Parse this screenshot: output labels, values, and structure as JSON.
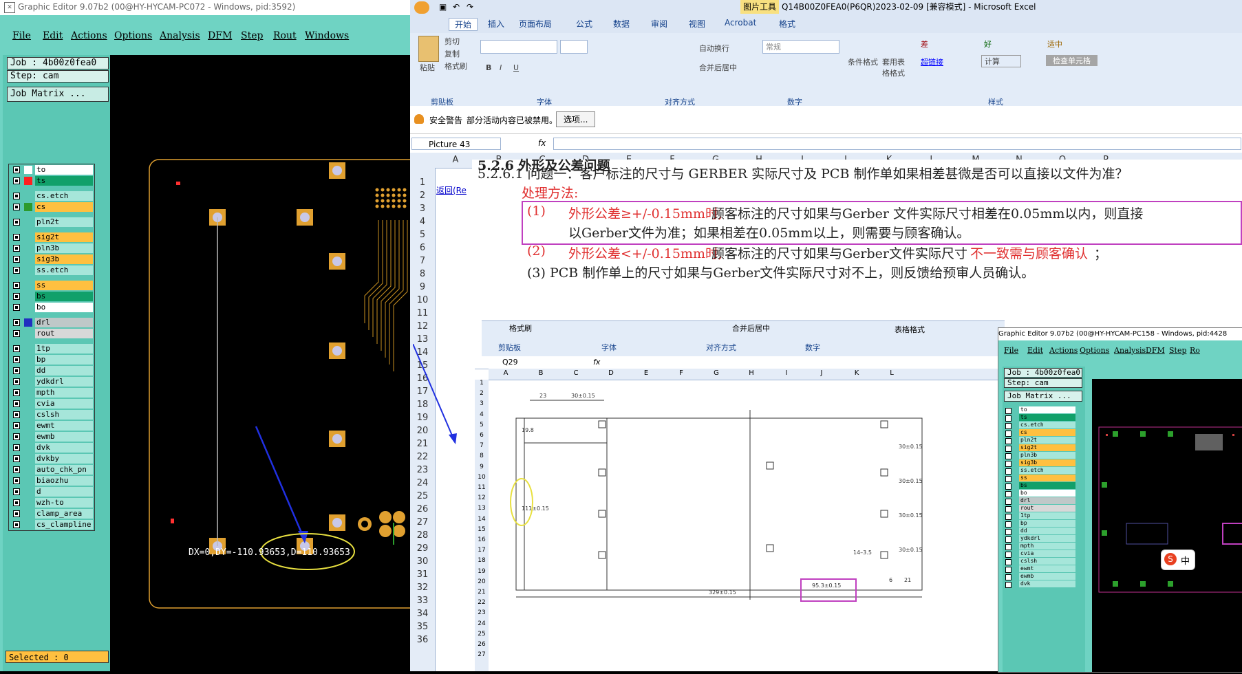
{
  "left_editor": {
    "title": "Graphic Editor 9.07b2 (00@HY-HYCAM-PC072 - Windows, pid:3592)",
    "menu": [
      "File",
      "Edit",
      "Actions",
      "Options",
      "Analysis",
      "DFM",
      "Step",
      "Rout",
      "Windows"
    ],
    "job": "Job : 4b00z0fea0",
    "step": "Step: cam",
    "job_matrix": "Job Matrix ...",
    "layers": [
      {
        "name": "to",
        "color": "#ffffff",
        "sw": "#ffffff"
      },
      {
        "name": "ts",
        "color": "#11a06a",
        "sw": "#ff2020"
      },
      {
        "name": "cs.etch",
        "color": "#a6e6da",
        "sw": "#5bc7b4"
      },
      {
        "name": "cs",
        "color": "#ffc040",
        "sw": "#2c9a2c"
      },
      {
        "name": "pln2t",
        "color": "#a6e6da",
        "sw": "#5bc7b4"
      },
      {
        "name": "sig2t",
        "color": "#ffc040",
        "sw": "#5bc7b4"
      },
      {
        "name": "pln3b",
        "color": "#a6e6da",
        "sw": "#5bc7b4"
      },
      {
        "name": "sig3b",
        "color": "#ffc040",
        "sw": "#5bc7b4"
      },
      {
        "name": "ss.etch",
        "color": "#a6e6da",
        "sw": "#5bc7b4"
      },
      {
        "name": "ss",
        "color": "#ffc040",
        "sw": "#5bc7b4"
      },
      {
        "name": "bs",
        "color": "#11a06a",
        "sw": "#5bc7b4"
      },
      {
        "name": "bo",
        "color": "#ffffff",
        "sw": "#5bc7b4"
      },
      {
        "name": "drl",
        "color": "#bfc8c8",
        "sw": "#2030c0"
      },
      {
        "name": "rout",
        "color": "#d8d8d8",
        "sw": "#5bc7b4"
      },
      {
        "name": "1tp",
        "color": "#a6e6da",
        "sw": "#5bc7b4"
      },
      {
        "name": "bp",
        "color": "#a6e6da",
        "sw": "#5bc7b4"
      },
      {
        "name": "dd",
        "color": "#a6e6da",
        "sw": "#5bc7b4"
      },
      {
        "name": "ydkdrl",
        "color": "#a6e6da",
        "sw": "#5bc7b4"
      },
      {
        "name": "mpth",
        "color": "#a6e6da",
        "sw": "#5bc7b4"
      },
      {
        "name": "cvia",
        "color": "#a6e6da",
        "sw": "#5bc7b4"
      },
      {
        "name": "cslsh",
        "color": "#a6e6da",
        "sw": "#5bc7b4"
      },
      {
        "name": "ewmt",
        "color": "#a6e6da",
        "sw": "#5bc7b4"
      },
      {
        "name": "ewmb",
        "color": "#a6e6da",
        "sw": "#5bc7b4"
      },
      {
        "name": "dvk",
        "color": "#a6e6da",
        "sw": "#5bc7b4"
      },
      {
        "name": "dvkby",
        "color": "#a6e6da",
        "sw": "#5bc7b4"
      },
      {
        "name": "auto_chk_pn",
        "color": "#a6e6da",
        "sw": "#5bc7b4"
      },
      {
        "name": "biaozhu",
        "color": "#a6e6da",
        "sw": "#5bc7b4"
      },
      {
        "name": "d",
        "color": "#a6e6da",
        "sw": "#5bc7b4"
      },
      {
        "name": "wzh-to",
        "color": "#a6e6da",
        "sw": "#5bc7b4"
      },
      {
        "name": "clamp_area",
        "color": "#a6e6da",
        "sw": "#5bc7b4"
      },
      {
        "name": "cs_clampline",
        "color": "#a6e6da",
        "sw": "#5bc7b4"
      }
    ],
    "measure": "DX=0,DY=-110.93653,D=110.93653",
    "selected": "Selected : 0"
  },
  "excel": {
    "ribbon_tool_label": "图片工具",
    "title": "Q14B00Z0FEA0(P6QR)2023-02-09 [兼容模式] - Microsoft Excel",
    "tabs": [
      "开始",
      "插入",
      "页面布局",
      "公式",
      "数据",
      "审阅",
      "视图",
      "Acrobat",
      "格式"
    ],
    "clipboard": {
      "paste": "粘贴",
      "cut": "剪切",
      "copy": "复制",
      "format_painter": "格式刷",
      "group": "剪贴板"
    },
    "font_group": "字体",
    "align": {
      "wrap": "自动换行",
      "merge": "合并后居中",
      "group": "对齐方式"
    },
    "number": {
      "format": "常规",
      "group": "数字"
    },
    "styles": {
      "cond": "条件格式",
      "table": "套用表格格式",
      "bad": "差",
      "good": "好",
      "neutral": "适中",
      "link": "超链接",
      "calc": "计算",
      "check": "检查单元格",
      "group": "样式"
    },
    "security": {
      "label": "安全警告",
      "msg": "部分活动内容已被禁用。",
      "btn": "选项..."
    },
    "name_box": "Picture 43",
    "fx": "fx",
    "columns": [
      "A",
      "B",
      "C",
      "D",
      "E",
      "F",
      "G",
      "H",
      "I",
      "J",
      "K",
      "L",
      "M",
      "N",
      "O",
      "P"
    ],
    "rows": [
      "1",
      "2",
      "3",
      "4",
      "5",
      "6",
      "7",
      "8",
      "9",
      "10",
      "11",
      "12",
      "13",
      "14",
      "15",
      "16",
      "17",
      "18",
      "19",
      "20",
      "21",
      "22",
      "23",
      "24",
      "25",
      "26",
      "27",
      "28",
      "29",
      "30",
      "31",
      "32",
      "33",
      "34",
      "35",
      "36"
    ],
    "back_link": "返回(Re",
    "doc": {
      "h1": "5.2.6 外形及公差问题",
      "q1": "5.2.6.1 问题一：客户标注的尺寸与 GERBER 实际尺寸及 PCB 制作单如果相差甚微是否可以直接以文件为准？",
      "method": "处理方法:",
      "p1_num": "(1)",
      "p1_red": "外形公差≥+/-0.15mm时,",
      "p1_rest": "顾客标注的尺寸如果与Gerber 文件实际尺寸相差在0.05mm以内，则直接",
      "p1_line2": "以Gerber文件为准；如果相差在0.05mm以上，则需要与顾客确认。",
      "p2_num": "(2)",
      "p2_red": "外形公差<+/-0.15mm时,",
      "p2_mid": "顾客标注的尺寸如果与Gerber文件实际尺寸",
      "p2_red2": "不一致需与顾客确认",
      "p2_end": "；",
      "p3": "(3) PCB 制作单上的尺寸如果与Gerber文件实际尺寸对不上，则反馈给预审人员确认。"
    },
    "inner": {
      "name_box": "Q29",
      "fx": "fx",
      "ribbon_items": [
        "格式刷",
        "剪贴板",
        "字体",
        "对齐方式",
        "合并后居中",
        "数字",
        "表格格式"
      ],
      "cols": [
        "A",
        "B",
        "C",
        "D",
        "E",
        "F",
        "G",
        "H",
        "I",
        "J",
        "K",
        "L"
      ],
      "rows": [
        "1",
        "2",
        "3",
        "4",
        "5",
        "6",
        "7",
        "8",
        "9",
        "10",
        "11",
        "12",
        "13",
        "14",
        "15",
        "16",
        "17",
        "18",
        "19",
        "20",
        "21",
        "22",
        "23",
        "24",
        "25",
        "26",
        "27"
      ],
      "dims": [
        "23",
        "30±0.15",
        "19.8",
        "111±0.15",
        "30±0.15",
        "30±0.15",
        "30±0.15",
        "30±0.15",
        "14–3.5",
        "6",
        "21",
        "95.3±0.15",
        "329±0.15"
      ]
    },
    "right_editor": {
      "title": "Graphic Editor 9.07b2 (00@HY-HYCAM-PC158 - Windows, pid:4428",
      "menu": [
        "File",
        "Edit",
        "Actions",
        "Options",
        "Analysis",
        "DFM",
        "Step",
        "Ro"
      ],
      "job": "Job : 4b00z0fea0",
      "step": "Step: cam",
      "job_matrix": "Job Matrix ...",
      "layers": [
        "to",
        "ts",
        "cs.etch",
        "cs",
        "pln2t",
        "sig2t",
        "pln3b",
        "sig3b",
        "ss.etch",
        "ss",
        "bs",
        "bo",
        "drl",
        "rout",
        "1tp",
        "bp",
        "dd",
        "ydkdrl",
        "mpth",
        "cvia",
        "cslsh",
        "ewmt",
        "ewmb",
        "dvk"
      ]
    },
    "ime": "中"
  }
}
